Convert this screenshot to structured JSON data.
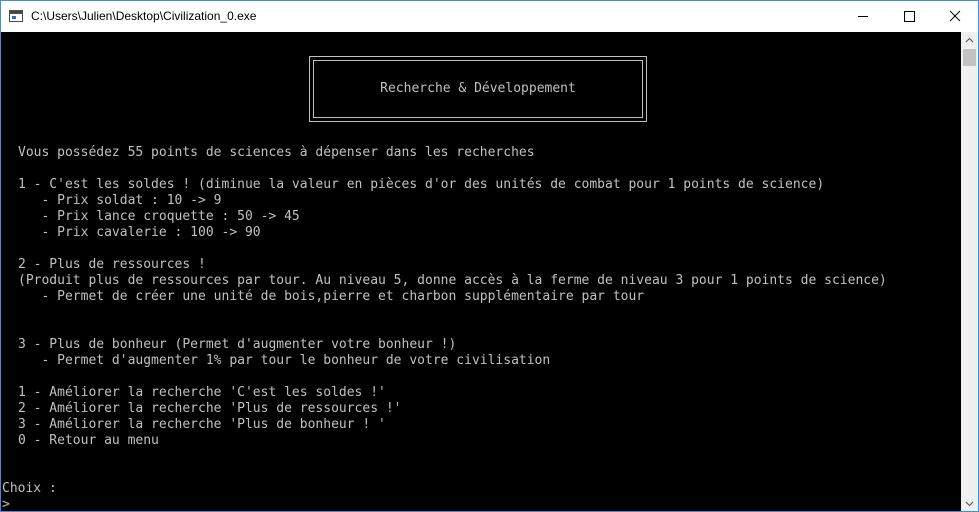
{
  "window": {
    "title": "C:\\Users\\Julien\\Desktop\\Civilization_0.exe"
  },
  "console": {
    "header_title": "Recherche & Développement",
    "points_line": "Vous possédez 55 points de sciences à dépenser dans les recherches",
    "research_1": {
      "title": "1 - C'est les soldes ! (diminue la valeur en pièces d'or des unités de combat pour 1 points de science)",
      "details": [
        "   - Prix soldat : 10 -> 9",
        "   - Prix lance croquette : 50 -> 45",
        "   - Prix cavalerie : 100 -> 90"
      ]
    },
    "research_2": {
      "title": "2 - Plus de ressources !",
      "description": "(Produit plus de ressources par tour. Au niveau 5, donne accès à la ferme de niveau 3 pour 1 points de science)",
      "details": [
        "   - Permet de créer une unité de bois,pierre et charbon supplémentaire par tour"
      ]
    },
    "research_3": {
      "title": "3 - Plus de bonheur (Permet d'augmenter votre bonheur !)",
      "details": [
        "   - Permet d'augmenter 1% par tour le bonheur de votre civilisation"
      ]
    },
    "menu": [
      "1 - Améliorer la recherche 'C'est les soldes !'",
      "2 - Améliorer la recherche 'Plus de ressources !'",
      "3 - Améliorer la recherche 'Plus de bonheur ! '",
      "0 - Retour au menu"
    ],
    "prompt_label": "Choix :",
    "prompt_cursor": ">"
  },
  "colors": {
    "console_bg": "#000000",
    "console_text": "#c0c0c0",
    "titlebar_bg": "#ffffff",
    "window_border": "#3a8fd8"
  },
  "icons": {
    "app": "console-app-icon",
    "minimize": "minimize-icon",
    "maximize": "maximize-icon",
    "close": "close-icon",
    "scroll_up": "scroll-up-arrow-icon",
    "scroll_down": "scroll-down-arrow-icon"
  }
}
